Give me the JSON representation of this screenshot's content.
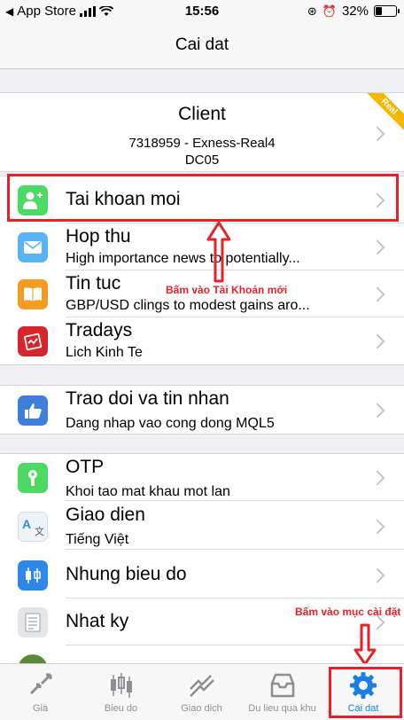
{
  "status": {
    "carrier": "App Store",
    "time": "15:56",
    "battery": "32%",
    "battery_level": 0.32
  },
  "nav": {
    "title": "Cai dat"
  },
  "account": {
    "name": "Client",
    "line1": "7318959 - Exness-Real4",
    "line2": "DC05",
    "ribbon": "Real",
    "ribbon_color": "#f5b800"
  },
  "groups": [
    {
      "items": [
        {
          "key": "tai-khoan-moi",
          "title": "Tai khoan moi",
          "subtitle": "",
          "icon": "add-user-icon",
          "color": "#4cd964"
        },
        {
          "key": "hop-thu",
          "title": "Hop thu",
          "subtitle": "High importance news to potentially...",
          "icon": "mail-icon",
          "color": "#5ab4f2"
        },
        {
          "key": "tin-tuc",
          "title": "Tin tuc",
          "subtitle": "GBP/USD clings to modest gains aro...",
          "icon": "book-icon",
          "color": "#f39c1f"
        },
        {
          "key": "tradays",
          "title": "Tradays",
          "subtitle": "Lich Kinh Te",
          "icon": "calendar-icon",
          "color": "#d6262b"
        }
      ]
    },
    {
      "items": [
        {
          "key": "trao-doi",
          "title": "Trao doi va tin nhan",
          "subtitle": "Dang nhap vao cong dong MQL5",
          "icon": "thumbs-up-icon",
          "color": "#3f7fd9"
        }
      ]
    },
    {
      "items": [
        {
          "key": "otp",
          "title": "OTP",
          "subtitle": "Khoi tao mat khau mot lan",
          "icon": "lock-icon",
          "color": "#4cd964"
        },
        {
          "key": "giao-dien",
          "title": "Giao dien",
          "subtitle": "Tiếng Việt",
          "icon": "translate-icon",
          "color": "#eef3fa"
        },
        {
          "key": "nhung-bieu-do",
          "title": "Nhung bieu do",
          "subtitle": "",
          "icon": "candles-icon",
          "color": "#2f87e8"
        },
        {
          "key": "nhat-ky",
          "title": "Nhat ky",
          "subtitle": "",
          "icon": "journal-icon",
          "color": "#e3e5e8"
        },
        {
          "key": "partial",
          "title": "",
          "subtitle": "",
          "icon": "globe-icon",
          "color": "#5c8a3a"
        }
      ]
    }
  ],
  "annotations": {
    "new_account": "Bấm vào Tài Khoản mới",
    "settings": "Bấm vào mục cài đặt",
    "color": "#e8202a"
  },
  "tabs": [
    {
      "key": "gia",
      "label": "Gia",
      "icon": "quotes-icon",
      "active": false
    },
    {
      "key": "bieu-do",
      "label": "Bieu do",
      "icon": "chart-icon",
      "active": false
    },
    {
      "key": "giao-dich",
      "label": "Giao dich",
      "icon": "trade-icon",
      "active": false
    },
    {
      "key": "du-lieu",
      "label": "Du lieu qua khu",
      "icon": "history-icon",
      "active": false
    },
    {
      "key": "cai-dat",
      "label": "Cai dat",
      "icon": "gear-icon",
      "active": true
    }
  ]
}
